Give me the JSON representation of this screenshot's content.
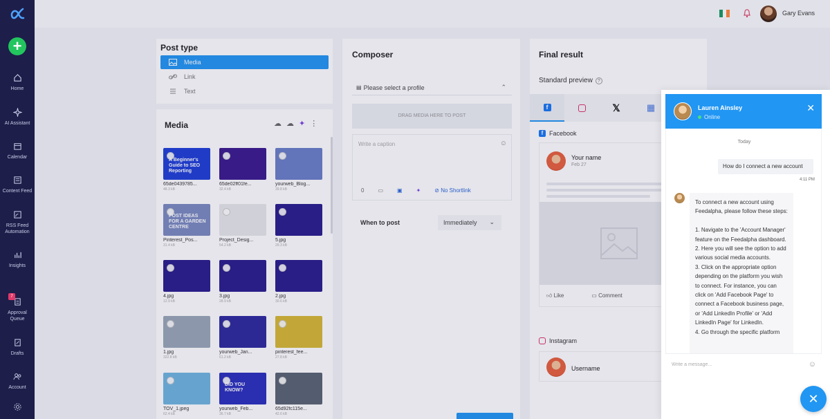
{
  "sidebar": {
    "items": [
      {
        "label": "Home",
        "icon": "home-icon"
      },
      {
        "label": "AI Assistant",
        "icon": "sparkle-icon"
      },
      {
        "label": "Calendar",
        "icon": "calendar-icon"
      },
      {
        "label": "Content Feed",
        "icon": "feed-icon"
      },
      {
        "label": "RSS Feed Automation",
        "icon": "rss-icon"
      },
      {
        "label": "Insights",
        "icon": "chart-icon"
      },
      {
        "label": "Approval Queue",
        "icon": "queue-icon",
        "badge": "7"
      },
      {
        "label": "Drafts",
        "icon": "drafts-icon"
      },
      {
        "label": "Account",
        "icon": "account-icon"
      }
    ]
  },
  "topbar": {
    "user_name": "Gary Evans"
  },
  "post_type": {
    "title": "Post type",
    "options": [
      "Media",
      "Link",
      "Text"
    ]
  },
  "media": {
    "title": "Media",
    "items": [
      {
        "name": "65de0439785...",
        "size": "48.3 kB",
        "label": "A Beginner's Guide to SEO Reporting",
        "bg": "#1f3fd6"
      },
      {
        "name": "65de02ff01fe...",
        "size": "32.4 kB",
        "label": "",
        "bg": "#3b1a8e"
      },
      {
        "name": "yourweb_Blog...",
        "size": "39.8 kB",
        "label": "",
        "bg": "#6a7fc8"
      },
      {
        "name": "Pinterest_Pos...",
        "size": "31.4 kB",
        "label": "POST IDEAS FOR A GARDEN CENTRE",
        "bg": "#7b8ac0"
      },
      {
        "name": "Project_Desig...",
        "size": "54.2 kB",
        "label": "",
        "bg": "#e8e8ea"
      },
      {
        "name": "5.jpg",
        "size": "29.3 kB",
        "label": "",
        "bg": "#2a1d8c"
      },
      {
        "name": "4.jpg",
        "size": "12.9 kB",
        "label": "",
        "bg": "#2a1d8c"
      },
      {
        "name": "3.jpg",
        "size": "28.9 kB",
        "label": "",
        "bg": "#2a1d8c"
      },
      {
        "name": "2.jpg",
        "size": "30.6 kB",
        "label": "",
        "bg": "#2a1d8c"
      },
      {
        "name": "1.jpg",
        "size": "322.8 kB",
        "label": "",
        "bg": "#9aa7b8"
      },
      {
        "name": "yourweb_Jan...",
        "size": "61.2 kB",
        "label": "",
        "bg": "#2d2a9e"
      },
      {
        "name": "pinterest_fee...",
        "size": "27.8 kB",
        "label": "",
        "bg": "#d8b934"
      },
      {
        "name": "TOV_1.jpeg",
        "size": "62.4 kB",
        "label": "",
        "bg": "#6fb5e0"
      },
      {
        "name": "yourweb_Feb...",
        "size": "36.7 kB",
        "label": "DID YOU KNOW?",
        "bg": "#2b2fbc"
      },
      {
        "name": "65d92fc115e...",
        "size": "42.6 kB",
        "label": "",
        "bg": "#5a6472"
      }
    ]
  },
  "composer": {
    "title": "Composer",
    "profile_placeholder": "Please select a profile",
    "drag_text": "DRAG MEDIA HERE TO POST",
    "caption_placeholder": "Write a caption",
    "char_count": "0",
    "shortlink_label": "No Shortlink",
    "when_label": "When to post",
    "when_value": "Immediately"
  },
  "final": {
    "title": "Final result",
    "preview_label": "Standard preview",
    "facebook_label": "Facebook",
    "your_name": "Your name",
    "date": "Feb 27",
    "like": "Like",
    "comment": "Comment",
    "instagram_label": "Instagram",
    "username": "Username"
  },
  "chat": {
    "agent_name": "Lauren Ainsley",
    "status": "Online",
    "day_label": "Today",
    "user_message": "How do I connect a new account",
    "time": "4:11 PM",
    "bot_message": "To connect a new account using Feedalpha, please follow these steps:\n\n1. Navigate to the 'Account Manager' feature on the Feedalpha dashboard.\n2. Here you will see the option to add various social media accounts.\n3. Click on the appropriate option depending on the platform you wish to connect. For instance, you can click on 'Add Facebook Page' to connect a Facebook business page, or 'Add LinkedIn Profile' or 'Add LinkedIn Page' for LinkedIn.\n4. Go through the specific platform",
    "input_placeholder": "Write a message..."
  },
  "colors": {
    "accent": "#2196f3",
    "sidebar": "#1e1e4a",
    "add": "#22c55e"
  }
}
